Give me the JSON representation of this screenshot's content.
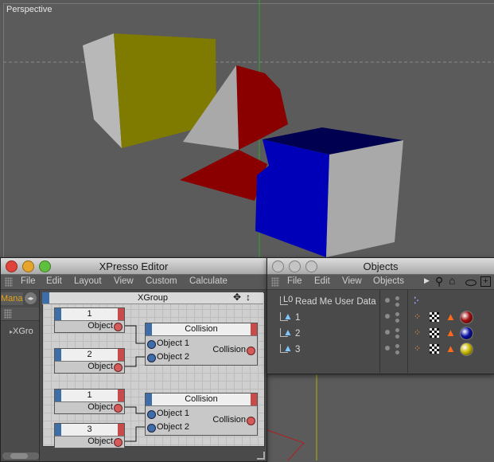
{
  "viewport": {
    "label": "Perspective"
  },
  "xpresso": {
    "title": "XPresso Editor",
    "menu": [
      "File",
      "Edit",
      "Layout",
      "View",
      "Custom",
      "Calculate"
    ],
    "left_panel": {
      "tab_label": "Manag",
      "tree_item": "XGro"
    },
    "group_title": "XGroup",
    "object_nodes": [
      {
        "title": "1",
        "port": "Object"
      },
      {
        "title": "2",
        "port": "Object"
      },
      {
        "title": "1",
        "port": "Object"
      },
      {
        "title": "3",
        "port": "Object"
      }
    ],
    "collision_nodes": [
      {
        "title": "Collision",
        "in1": "Object 1",
        "in2": "Object 2",
        "out": "Collision"
      },
      {
        "title": "Collision",
        "in1": "Object 1",
        "in2": "Object 2",
        "out": "Collision"
      }
    ]
  },
  "objects": {
    "title": "Objects",
    "menu": [
      "File",
      "Edit",
      "View",
      "Objects"
    ],
    "rows": [
      {
        "name": "Read Me User Data",
        "type": "null"
      },
      {
        "name": "1",
        "type": "object",
        "material": "#a01010"
      },
      {
        "name": "2",
        "type": "object",
        "material": "#0a10a0"
      },
      {
        "name": "3",
        "type": "object",
        "material": "#c8b800"
      }
    ]
  },
  "colors": {
    "cube_yellow": "#7f7a00",
    "cube_red": "#8a0000",
    "cube_blue": "#0000b8",
    "cube_grey": "#a9a9a9"
  }
}
